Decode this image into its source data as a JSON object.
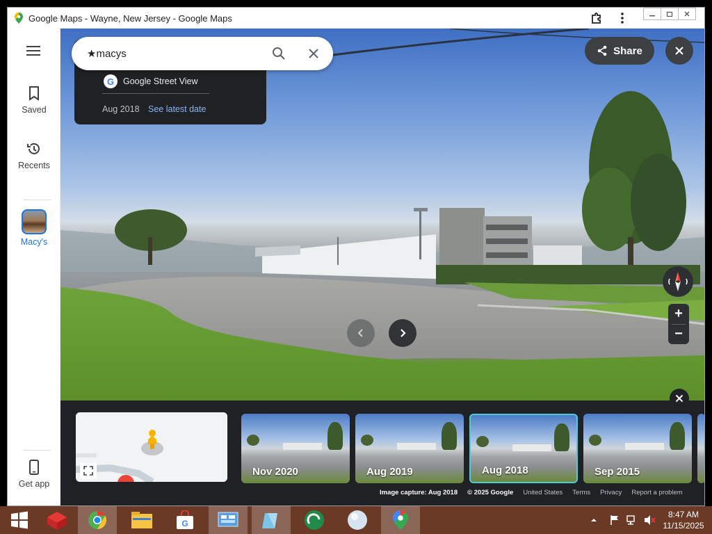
{
  "window": {
    "title": "Google Maps - Wayne, New Jersey - Google Maps"
  },
  "rail": {
    "saved_label": "Saved",
    "recents_label": "Recents",
    "place_label": "Macy's",
    "get_app_label": "Get app"
  },
  "search": {
    "value": "★macys"
  },
  "info_card": {
    "source": "Google Street View",
    "date": "Aug 2018",
    "latest_link": "See latest date"
  },
  "actions": {
    "share_label": "Share"
  },
  "zoom": {
    "in_label": "+",
    "out_label": "−"
  },
  "filmstrip": {
    "thumbnails": [
      {
        "label": "Nov 2020",
        "selected": false
      },
      {
        "label": "Aug 2019",
        "selected": false
      },
      {
        "label": "Aug 2018",
        "selected": true
      },
      {
        "label": "Sep 2015",
        "selected": false
      }
    ],
    "selected_color": "#4ecbd6"
  },
  "attribution": {
    "capture": "Image capture: Aug 2018",
    "copyright": "© 2025 Google",
    "region": "United States",
    "terms": "Terms",
    "privacy": "Privacy",
    "report": "Report a problem"
  },
  "taskbar": {
    "time": "8:47 AM",
    "date": "11/15/2025",
    "apps": [
      "windows-start",
      "red-box-app",
      "chrome",
      "file-explorer",
      "google-store",
      "control-panel",
      "notepad-app",
      "edge-style-app",
      "sphere-app",
      "google-maps-app"
    ]
  },
  "colors": {
    "accent": "#1a73e8",
    "link": "#8ab4f8",
    "taskbar": "#6b3a26",
    "dark_panel": "#202124"
  }
}
